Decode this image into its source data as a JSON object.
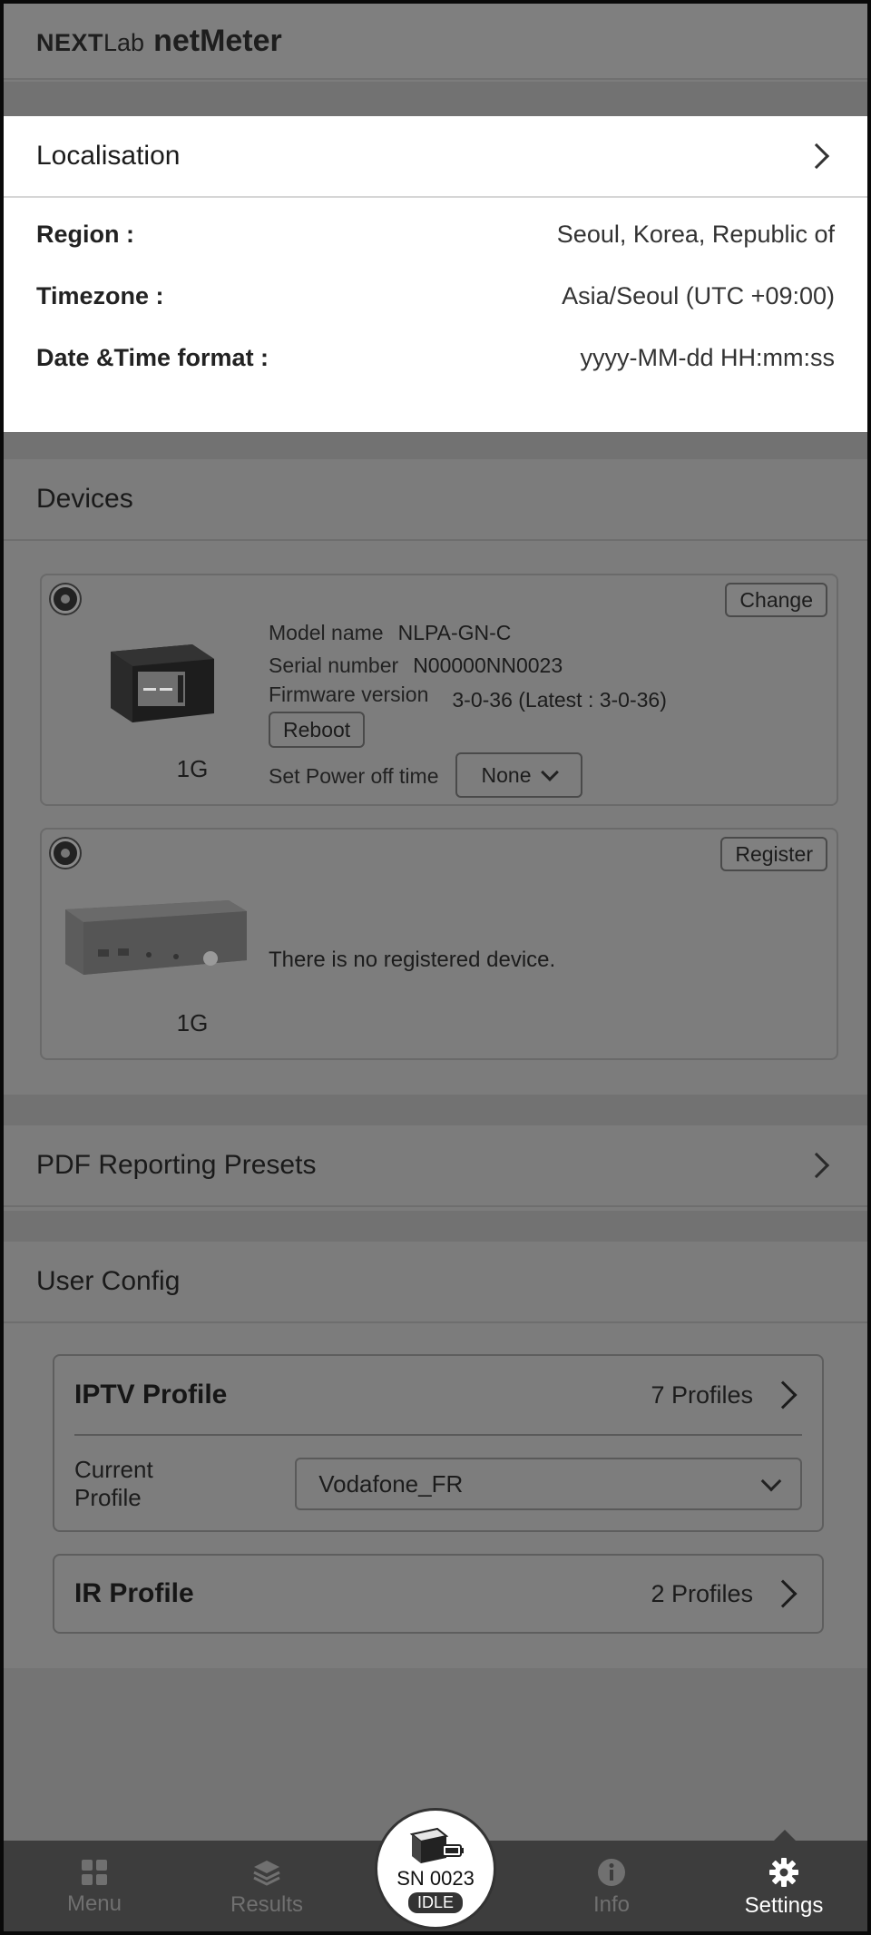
{
  "header": {
    "brand": "NEXT",
    "brand_suffix": "Lab",
    "product": "netMeter"
  },
  "localisation": {
    "title": "Localisation",
    "rows": [
      {
        "label": "Region :",
        "value": "Seoul, Korea, Republic of"
      },
      {
        "label": "Timezone :",
        "value": "Asia/Seoul (UTC +09:00)"
      },
      {
        "label": "Date &Time format :",
        "value": "yyyy-MM-dd HH:mm:ss"
      }
    ]
  },
  "devices": {
    "title": "Devices",
    "card1": {
      "button": "Change",
      "speed": "1G",
      "model_label": "Model name",
      "model_value": "NLPA-GN-C",
      "serial_label": "Serial number",
      "serial_value": "N00000NN0023",
      "firmware_label": "Firmware version",
      "firmware_value": "3-0-36 (Latest : 3-0-36)",
      "reboot": "Reboot",
      "power_label": "Set Power off time",
      "power_value": "None"
    },
    "card2": {
      "button": "Register",
      "speed": "1G",
      "message": "There is no registered device."
    }
  },
  "pdf": {
    "title": "PDF Reporting Presets"
  },
  "user_config": {
    "title": "User Config",
    "iptv": {
      "title": "IPTV Profile",
      "count": "7 Profiles",
      "current_label": "Current Profile",
      "current_value": "Vodafone_FR"
    },
    "ir": {
      "title": "IR Profile",
      "count": "2 Profiles"
    }
  },
  "nav": {
    "menu": "Menu",
    "results": "Results",
    "info": "Info",
    "settings": "Settings",
    "center_sn": "SN 0023",
    "center_status": "IDLE"
  }
}
